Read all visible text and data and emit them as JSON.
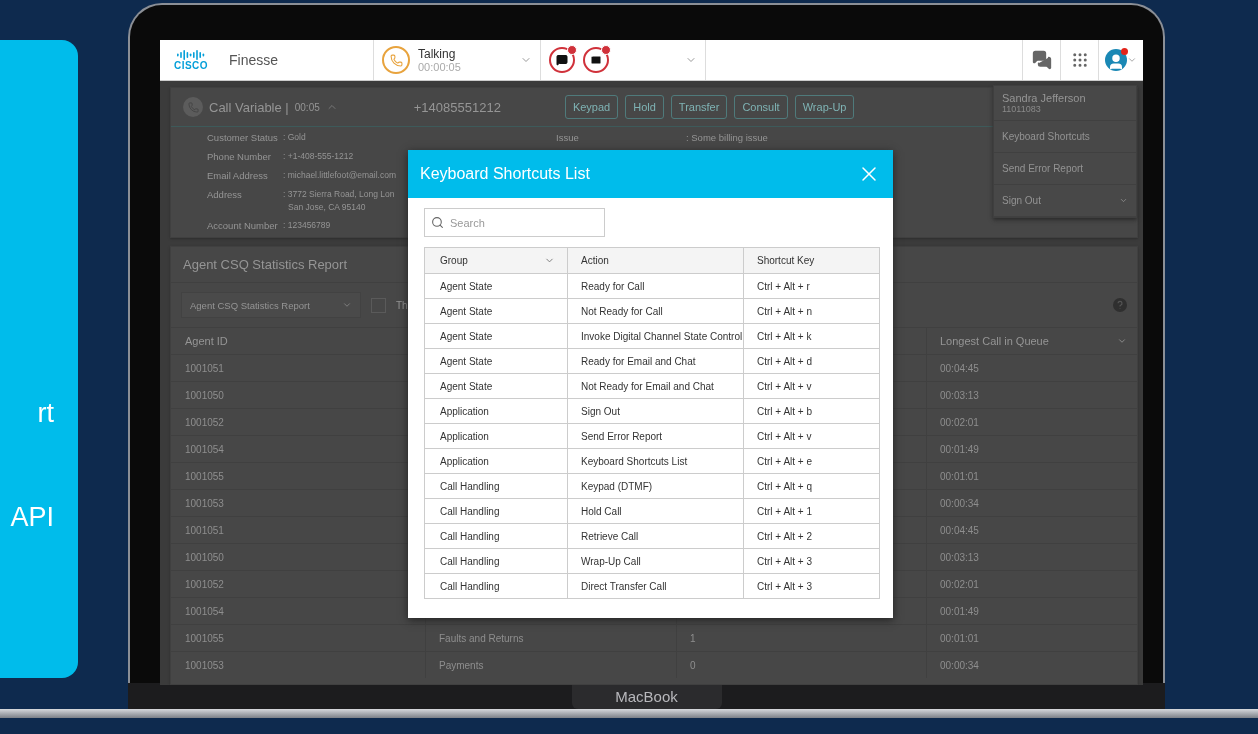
{
  "promo_card": {
    "lines": [
      "rt",
      "API"
    ]
  },
  "laptop": {
    "brand": "MacBook"
  },
  "header": {
    "logo_text": "CISCO",
    "app_name": "Finesse",
    "call_state": {
      "label": "Talking",
      "timer": "00:00:05"
    }
  },
  "call_panel": {
    "title": "Call Variable |",
    "timer": "00:05",
    "expanded": true,
    "number": "+14085551212",
    "buttons": [
      "Keypad",
      "Hold",
      "Transfer",
      "Consult",
      "Wrap-Up"
    ],
    "fields": [
      {
        "label": "Customer Status",
        "value": ": Gold"
      },
      {
        "label": "Phone Number",
        "value": ": +1-408-555-1212"
      },
      {
        "label": "Email Address",
        "value": ": michael.littlefoot@email.com"
      },
      {
        "label": "Address",
        "value": ": 3772 Sierra Road, Long Lon",
        "value_2": "San Jose, CA 95140"
      },
      {
        "label": "Account Number",
        "value": ": 123456789"
      }
    ],
    "issue": {
      "label": "Issue",
      "value": ": Some billing issue"
    }
  },
  "report": {
    "title": "Agent CSQ Statistics Report",
    "selector": "Agent CSQ Statistics Report",
    "checkbox": {
      "checked": false,
      "label": "Th"
    },
    "columns": {
      "agent_id": "Agent ID",
      "longest_call": "Longest Call in Queue"
    },
    "rows": [
      {
        "agent_id": "1001051",
        "longest_call": "00:04:45"
      },
      {
        "agent_id": "1001050",
        "longest_call": "00:03:13"
      },
      {
        "agent_id": "1001052",
        "longest_call": "00:02:01"
      },
      {
        "agent_id": "1001054",
        "longest_call": "00:01:49"
      },
      {
        "agent_id": "1001055",
        "longest_call": "00:01:01"
      },
      {
        "agent_id": "1001053",
        "longest_call": "00:00:34"
      },
      {
        "agent_id": "1001051",
        "longest_call": "00:04:45"
      },
      {
        "agent_id": "1001050",
        "longest_call": "00:03:13"
      },
      {
        "agent_id": "1001052",
        "longest_call": "00:02:01"
      },
      {
        "agent_id": "1001054",
        "longest_call": "00:01:49"
      },
      {
        "agent_id": "1001055",
        "column_2": "Faults and Returns",
        "column_3": "1",
        "longest_call": "00:01:01"
      },
      {
        "agent_id": "1001053",
        "column_2": "Payments",
        "column_3": "0",
        "longest_call": "00:00:34"
      }
    ]
  },
  "user_menu": {
    "name": "Sandra Jefferson",
    "id": "11011083",
    "items": [
      "Keyboard Shortcuts",
      "Send Error Report",
      "Sign Out"
    ]
  },
  "dialog": {
    "title": "Keyboard Shortcuts List",
    "search_placeholder": "Search",
    "columns": [
      "Group",
      "Action",
      "Shortcut Key"
    ],
    "rows": [
      {
        "group": "Agent State",
        "action": "Ready for Call",
        "key": "Ctrl + Alt + r"
      },
      {
        "group": "Agent State",
        "action": "Not Ready for Call",
        "key": "Ctrl + Alt + n"
      },
      {
        "group": "Agent State",
        "action": "Invoke Digital Channel State Control",
        "key": "Ctrl + Alt + k"
      },
      {
        "group": "Agent State",
        "action": "Ready for Email and Chat",
        "key": "Ctrl + Alt + d"
      },
      {
        "group": "Agent State",
        "action": "Not Ready for Email and Chat",
        "key": "Ctrl + Alt + v"
      },
      {
        "group": "Application",
        "action": "Sign Out",
        "key": "Ctrl + Alt + b"
      },
      {
        "group": "Application",
        "action": "Send Error Report",
        "key": "Ctrl + Alt + v"
      },
      {
        "group": "Application",
        "action": "Keyboard Shortcuts List",
        "key": "Ctrl + Alt + e"
      },
      {
        "group": "Call Handling",
        "action": "Keypad (DTMF)",
        "key": "Ctrl + Alt + q"
      },
      {
        "group": "Call Handling",
        "action": "Hold Call",
        "key": "Ctrl + Alt + 1"
      },
      {
        "group": "Call Handling",
        "action": "Retrieve Call",
        "key": "Ctrl + Alt + 2"
      },
      {
        "group": "Call Handling",
        "action": "Wrap-Up Call",
        "key": "Ctrl + Alt + 3"
      },
      {
        "group": "Call Handling",
        "action": "Direct Transfer Call",
        "key": "Ctrl + Alt + 3"
      }
    ]
  }
}
